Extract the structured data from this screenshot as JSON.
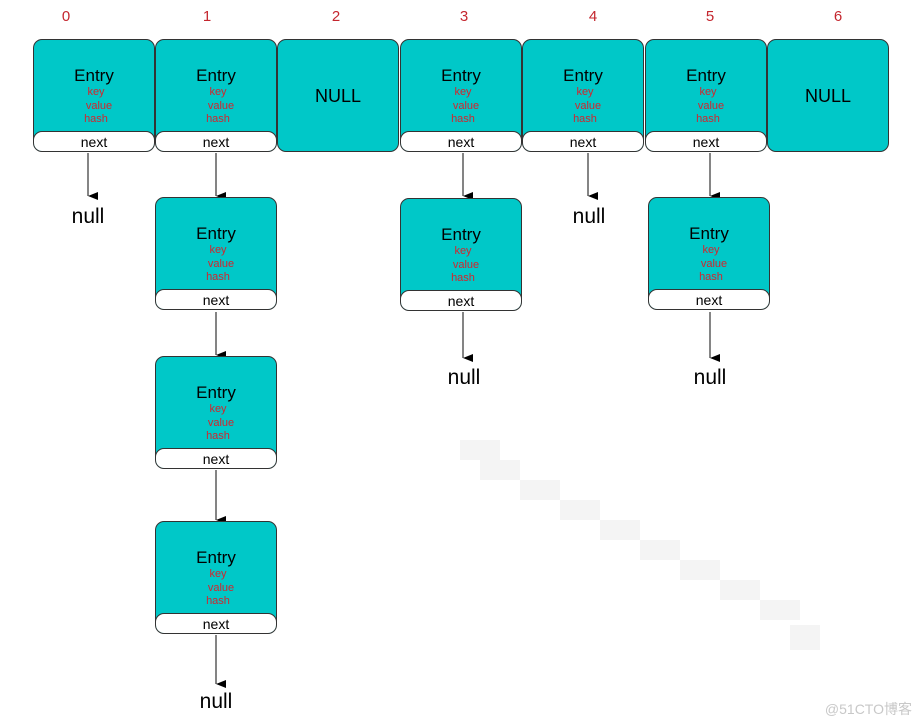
{
  "diagram": {
    "type": "hashmap-bucket-array",
    "bucket_indices": [
      "0",
      "1",
      "2",
      "3",
      "4",
      "5",
      "6"
    ],
    "entry_title": "Entry",
    "entry_fields": [
      "key",
      "value",
      "hash"
    ],
    "next_label": "next",
    "null_bucket_label": "NULL",
    "null_terminator_label": "null",
    "buckets": [
      {
        "index": "0",
        "chain_length": 1
      },
      {
        "index": "1",
        "chain_length": 4
      },
      {
        "index": "2",
        "chain_length": 0
      },
      {
        "index": "3",
        "chain_length": 2
      },
      {
        "index": "4",
        "chain_length": 1
      },
      {
        "index": "5",
        "chain_length": 2
      },
      {
        "index": "6",
        "chain_length": 0
      }
    ],
    "colors": {
      "entry_fill": "#00c8c8",
      "index_text": "#c4262e",
      "field_text": "#d0262e",
      "outline": "#333333"
    }
  },
  "watermark": "@51CTO博客"
}
